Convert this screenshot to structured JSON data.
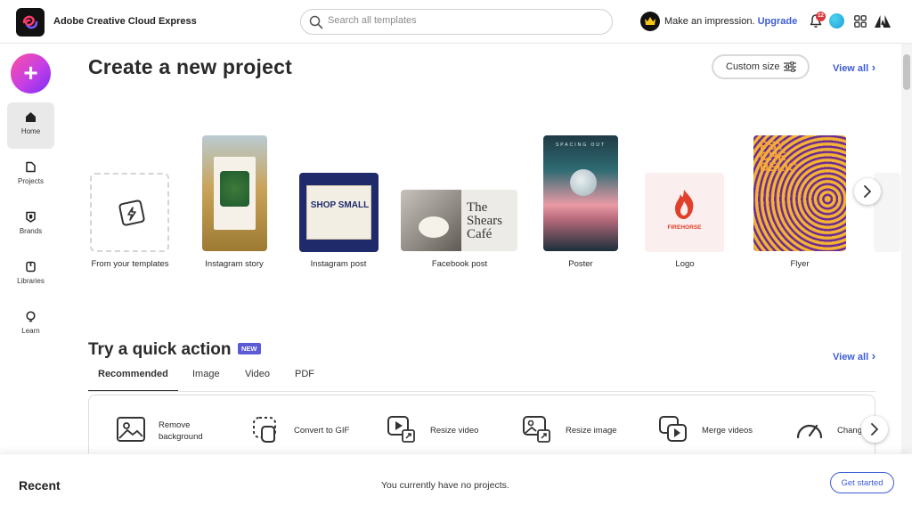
{
  "header": {
    "app_title": "Adobe Creative Cloud Express",
    "search": {
      "placeholder": "Search all templates"
    },
    "upsell_text": "Make an impression.",
    "upgrade_label": "Upgrade",
    "notification_count": "12"
  },
  "sidebar": {
    "create_label": "+",
    "items": [
      {
        "label": "Home",
        "icon": "home-icon",
        "active": true
      },
      {
        "label": "Projects",
        "icon": "projects-icon"
      },
      {
        "label": "Brands",
        "icon": "brands-icon"
      },
      {
        "label": "Libraries",
        "icon": "libraries-icon"
      },
      {
        "label": "Learn",
        "icon": "learn-icon"
      }
    ]
  },
  "create": {
    "title": "Create a new project",
    "custom_size_label": "Custom size",
    "view_all_label": "View all",
    "projects": [
      {
        "label": "From your templates"
      },
      {
        "label": "Instagram story"
      },
      {
        "label": "Instagram post",
        "art_text": "SHOP SMALL"
      },
      {
        "label": "Facebook post",
        "art_text": "The Shears Café"
      },
      {
        "label": "Poster",
        "art_text": "SPACING OUT"
      },
      {
        "label": "Logo",
        "art_text": "FIREHORSE"
      },
      {
        "label": "Flyer",
        "art_text": "PSY CHE DELIC"
      }
    ]
  },
  "quick_actions": {
    "title": "Try a quick action",
    "badge": "NEW",
    "view_all_label": "View all",
    "tabs": [
      "Recommended",
      "Image",
      "Video",
      "PDF"
    ],
    "active_tab": "Recommended",
    "actions": [
      {
        "label": "Remove background",
        "icon": "remove-background-icon"
      },
      {
        "label": "Convert to GIF",
        "icon": "convert-gif-icon"
      },
      {
        "label": "Resize video",
        "icon": "resize-video-icon"
      },
      {
        "label": "Resize image",
        "icon": "resize-image-icon"
      },
      {
        "label": "Merge videos",
        "icon": "merge-videos-icon"
      },
      {
        "label": "Chang",
        "icon": "change-speed-icon"
      }
    ]
  },
  "recent": {
    "title": "Recent",
    "empty_text": "You currently have no projects.",
    "get_started_label": "Get started"
  },
  "colors": {
    "accent": "#3d5cd6",
    "create_gradient_start": "#ff4fa0",
    "create_gradient_end": "#7a2cf5",
    "badge_new": "#5b5bd6",
    "notification": "#d7373f"
  }
}
